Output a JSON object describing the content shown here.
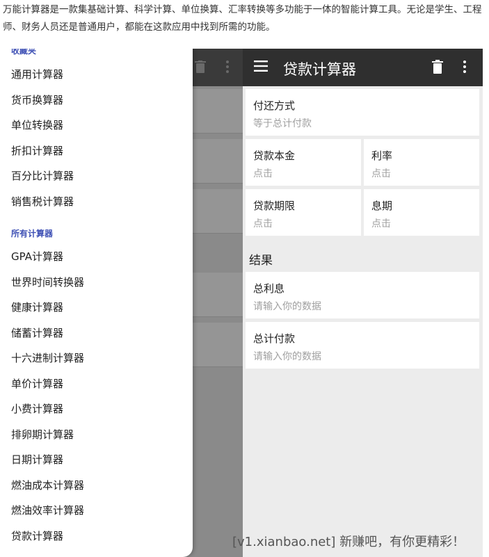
{
  "intro": {
    "text": "万能计算器是一款集基础计算、科学计算、单位换算、汇率转换等多功能于一体的智能计算工具。无论是学生、工程师、财务人员还是普通用户，都能在这款应用中找到所需的功能。"
  },
  "drawer": {
    "favorites_title": "收藏夹",
    "favorites": [
      "通用计算器",
      "货币换算器",
      "单位转换器",
      "折扣计算器",
      "百分比计算器",
      "销售税计算器"
    ],
    "all_title": "所有计算器",
    "all": [
      "GPA计算器",
      "世界时间转换器",
      "健康计算器",
      "储蓄计算器",
      "十六进制计算器",
      "单价计算器",
      "小费计算器",
      "排卵期计算器",
      "日期计算器",
      "燃油成本计算器",
      "燃油效率计算器",
      "贷款计算器"
    ]
  },
  "loan": {
    "title": "贷款计算器",
    "payment_method": {
      "label": "付还方式",
      "value": "等于总计付款"
    },
    "principal": {
      "label": "贷款本金",
      "value": "点击"
    },
    "rate": {
      "label": "利率",
      "value": "点击"
    },
    "term": {
      "label": "贷款期限",
      "value": "点击"
    },
    "period": {
      "label": "息期",
      "value": "点击"
    },
    "results_title": "结果",
    "total_interest": {
      "label": "总利息",
      "value": "请输入你的数据"
    },
    "total_payment": {
      "label": "总计付款",
      "value": "请输入你的数据"
    }
  },
  "watermark": "[v1.xianbao.net] 新赚吧，有你更精彩！",
  "colors": {
    "appbar": "#2f2f2f",
    "accent_section": "#3f51b5",
    "background": "#ececec",
    "placeholder": "#a0a0a0"
  },
  "icons": {
    "menu": "hamburger-menu-icon",
    "trash": "trash-icon",
    "more": "more-vert-icon"
  }
}
